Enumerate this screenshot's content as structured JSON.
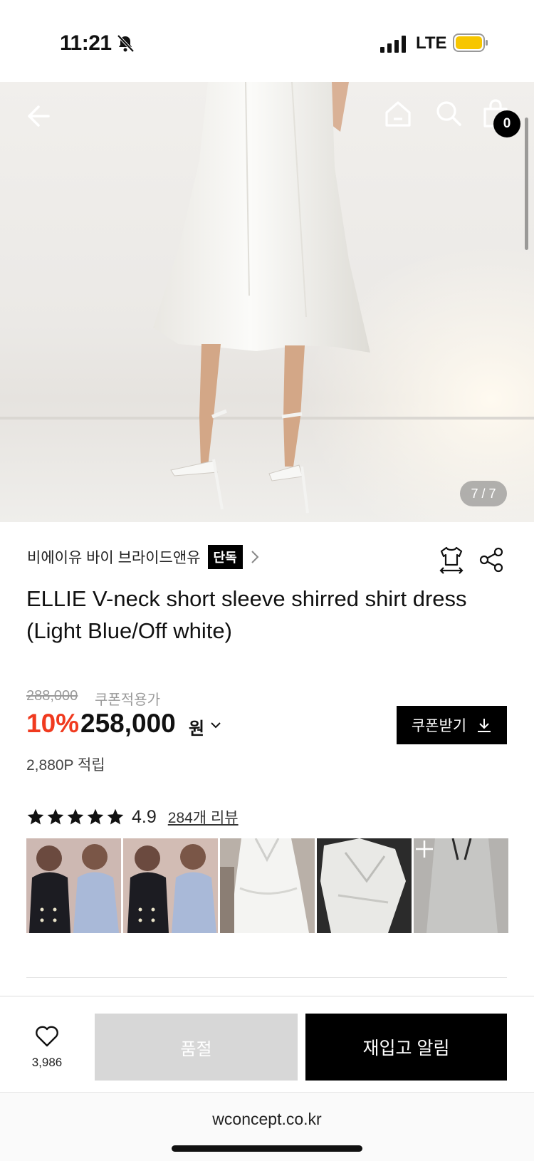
{
  "status_bar": {
    "time": "11:21",
    "network": "LTE"
  },
  "gallery": {
    "page_indicator": "7 / 7",
    "cart_count": "0"
  },
  "product": {
    "brand": "비에이유 바이 브라이드앤유",
    "exclusive_badge": "단독",
    "title": "ELLIE V-neck short sleeve shirred shirt dress (Light Blue/Off white)",
    "original_price": "288,000",
    "coupon_note": "쿠폰적용가",
    "discount": "10%",
    "price": "258,000",
    "currency": "원",
    "points": "2,880P 적립",
    "coupon_button": "쿠폰받기"
  },
  "reviews": {
    "stars": 5,
    "rating": "4.9",
    "review_link": "284개 리뷰"
  },
  "bottom_bar": {
    "wish_count": "3,986",
    "soldout_label": "품절",
    "restock_label": "재입고 알림"
  },
  "browser": {
    "url": "wconcept.co.kr"
  },
  "colors": {
    "accent_red": "#f03a1f",
    "black": "#000000",
    "soldout_gray": "#d7d7d7"
  },
  "icons": [
    "back-arrow-icon",
    "home-icon",
    "search-icon",
    "bag-icon",
    "size-guide-icon",
    "share-icon",
    "star-icon",
    "heart-icon",
    "download-icon",
    "plus-icon",
    "bell-muted-icon",
    "signal-icon",
    "battery-icon"
  ]
}
